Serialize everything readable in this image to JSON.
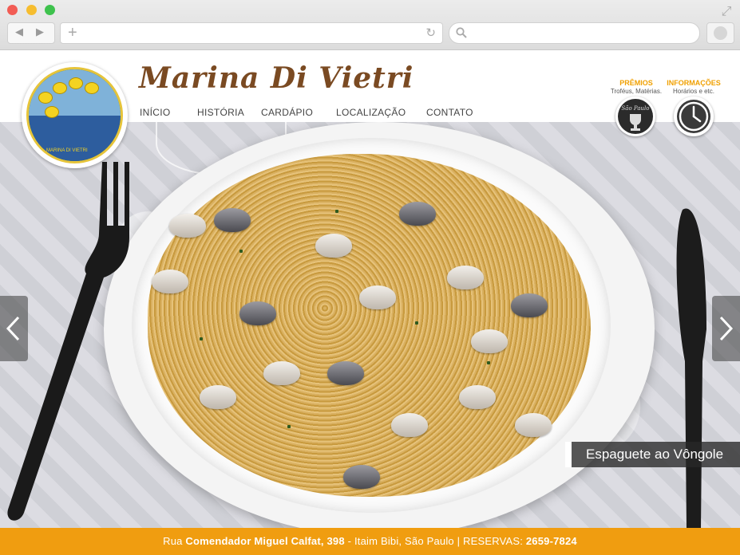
{
  "site": {
    "brand": "Marina Di Vietri",
    "badge_text": "MARINA DI VIETRI"
  },
  "menu": {
    "items": [
      {
        "label": "INÍCIO"
      },
      {
        "label": "HISTÓRIA"
      },
      {
        "label": "CARDÁPIO"
      },
      {
        "label": "LOCALIZAÇÃO"
      },
      {
        "label": "CONTATO"
      }
    ]
  },
  "info": {
    "premios": {
      "title": "PRÊMIOS",
      "subtitle": "Troféus, Matérias."
    },
    "informacoes": {
      "title": "INFORMAÇÕES",
      "subtitle": "Horários e etc."
    },
    "sao_paulo_label": "São Paulo"
  },
  "slider": {
    "caption": "Espaguete ao Vôngole"
  },
  "footer": {
    "prefix": "Rua ",
    "street": "Comendador Miguel Calfat, 398",
    "neighborhood": " - Itaim Bibi, São Paulo | ",
    "reservas_label": "RESERVAS: ",
    "phone": "2659-7824"
  },
  "colors": {
    "accent": "#f09d10",
    "brand_brown": "#7a4a22",
    "info_heading": "#f0a000"
  },
  "icons": [
    "back-icon",
    "forward-icon",
    "new-tab-icon",
    "reload-icon",
    "search-icon",
    "profile-icon",
    "expand-icon",
    "trophy-icon",
    "clock-icon",
    "chevron-left-icon",
    "chevron-right-icon"
  ]
}
